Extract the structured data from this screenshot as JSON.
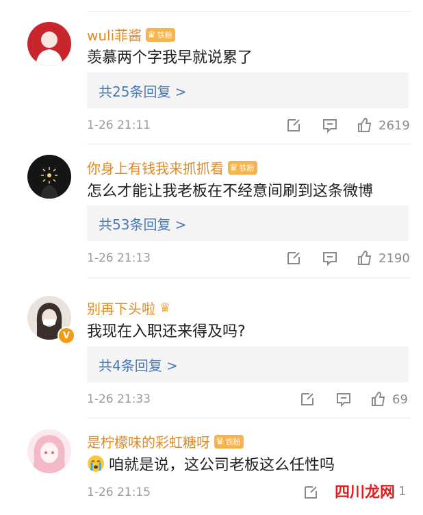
{
  "comments": [
    {
      "username": "wuli菲酱",
      "badge": "铁粉",
      "text": "羡慕两个字我早就说累了",
      "replies": "共25条回复 >",
      "time": "1-26 21:11",
      "likes": "2619"
    },
    {
      "username": "你身上有钱我来抓抓看",
      "badge": "铁粉",
      "text": "怎么才能让我老板在不经意间刷到这条微博",
      "replies": "共53条回复 >",
      "time": "1-26 21:13",
      "likes": "2190"
    },
    {
      "username": "别再下头啦",
      "badge": "",
      "verified_mark": "V",
      "text": "我现在入职还来得及吗?",
      "replies": "共4条回复 >",
      "time": "1-26 21:33",
      "likes": "69"
    },
    {
      "username": "是柠檬味的彩虹糖呀",
      "badge": "铁粉",
      "text": "咱就是说，这公司老板这么任性吗",
      "time": "1-26 21:15",
      "likes": "1",
      "emoji": "crying-face"
    }
  ],
  "watermark": "四川龙网",
  "colors": {
    "username": "#e08a24",
    "link": "#4a79b8",
    "meta": "#9b9b9b",
    "badge": "#f7b34d"
  }
}
